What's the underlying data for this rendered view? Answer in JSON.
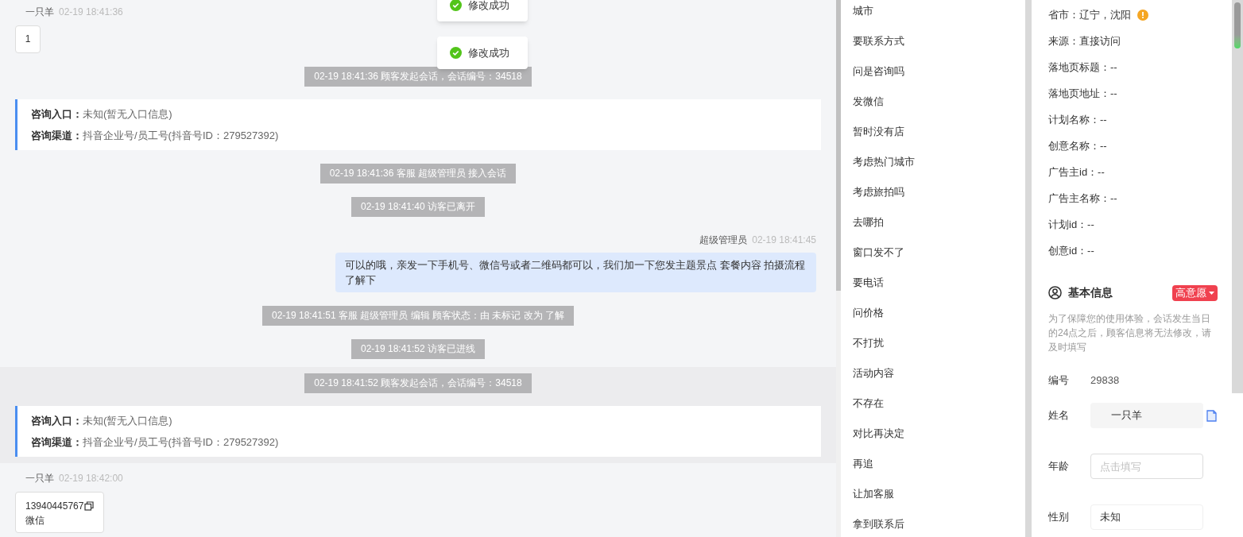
{
  "toasts": [
    {
      "text": "修改成功"
    },
    {
      "text": "修改成功"
    }
  ],
  "chat": [
    {
      "kind": "customer",
      "band": false,
      "name": "一只羊",
      "time": "02-19 18:41:36",
      "text": "1"
    },
    {
      "kind": "system",
      "band": false,
      "text": "02-19 18:41:36 顾客发起会话，会话编号：34518"
    },
    {
      "kind": "entry",
      "band": false,
      "rows": [
        {
          "label": "咨询入口：",
          "value": "未知(暂无入口信息)"
        },
        {
          "label": "咨询渠道：",
          "value": "抖音企业号/员工号(抖音号ID：279527392)"
        }
      ]
    },
    {
      "kind": "system",
      "band": false,
      "text": "02-19 18:41:36 客服 超级管理员 接入会话"
    },
    {
      "kind": "system",
      "band": false,
      "text": "02-19 18:41:40 访客已离开"
    },
    {
      "kind": "agent",
      "band": false,
      "name": "超级管理员",
      "time": "02-19 18:41:45",
      "text": "可以的哦，亲发一下手机号、微信号或者二维码都可以，我们加一下您发主题景点 套餐内容 拍摄流程了解下"
    },
    {
      "kind": "system",
      "band": false,
      "text": "02-19 18:41:51 客服 超级管理员 编辑 顾客状态：由 未标记 改为 了解"
    },
    {
      "kind": "system",
      "band": false,
      "text": "02-19 18:41:52 访客已进线"
    },
    {
      "kind": "system",
      "band": true,
      "text": "02-19 18:41:52 顾客发起会话，会话编号：34518"
    },
    {
      "kind": "entry",
      "band": true,
      "rows": [
        {
          "label": "咨询入口：",
          "value": "未知(暂无入口信息)"
        },
        {
          "label": "咨询渠道：",
          "value": "抖音企业号/员工号(抖音号ID：279527392)"
        }
      ]
    },
    {
      "kind": "contact",
      "band": false,
      "name": "一只羊",
      "time": "02-19 18:42:00",
      "text": "13940445767",
      "sub": "微信"
    }
  ],
  "phrases": [
    "城市",
    "要联系方式",
    "问是咨询吗",
    "发微信",
    "暂时没有店",
    "考虑热门城市",
    "考虑旅拍吗",
    "去哪拍",
    "窗口发不了",
    "要电话",
    "问价格",
    "不打扰",
    "活动内容",
    "不存在",
    "对比再决定",
    "再追",
    "让加客服",
    "拿到联系后"
  ],
  "visitor_info": [
    {
      "text": "省市：辽宁，沈阳",
      "warning": true
    },
    {
      "text": "来源：直接访问",
      "warning": false
    },
    {
      "text": "落地页标题：--",
      "warning": false
    },
    {
      "text": "落地页地址：--",
      "warning": false
    },
    {
      "text": "计划名称：--",
      "warning": false
    },
    {
      "text": "创意名称：--",
      "warning": false
    },
    {
      "text": "广告主id：--",
      "warning": false
    },
    {
      "text": "广告主名称：--",
      "warning": false
    },
    {
      "text": "计划id：--",
      "warning": false
    },
    {
      "text": "创意id：--",
      "warning": false
    }
  ],
  "basic_info": {
    "title": "基本信息",
    "intent": "高意愿",
    "note": "为了保障您的使用体验，会话发生当日的24点之后，顾客信息将无法修改，请及时填写",
    "fields": [
      {
        "kind": "text",
        "label": "编号",
        "value": "29838"
      },
      {
        "kind": "readonly",
        "label": "姓名",
        "value": "一只羊"
      },
      {
        "kind": "input",
        "label": "年龄",
        "placeholder": "点击填写"
      },
      {
        "kind": "select",
        "label": "性别",
        "value": "未知"
      }
    ]
  }
}
